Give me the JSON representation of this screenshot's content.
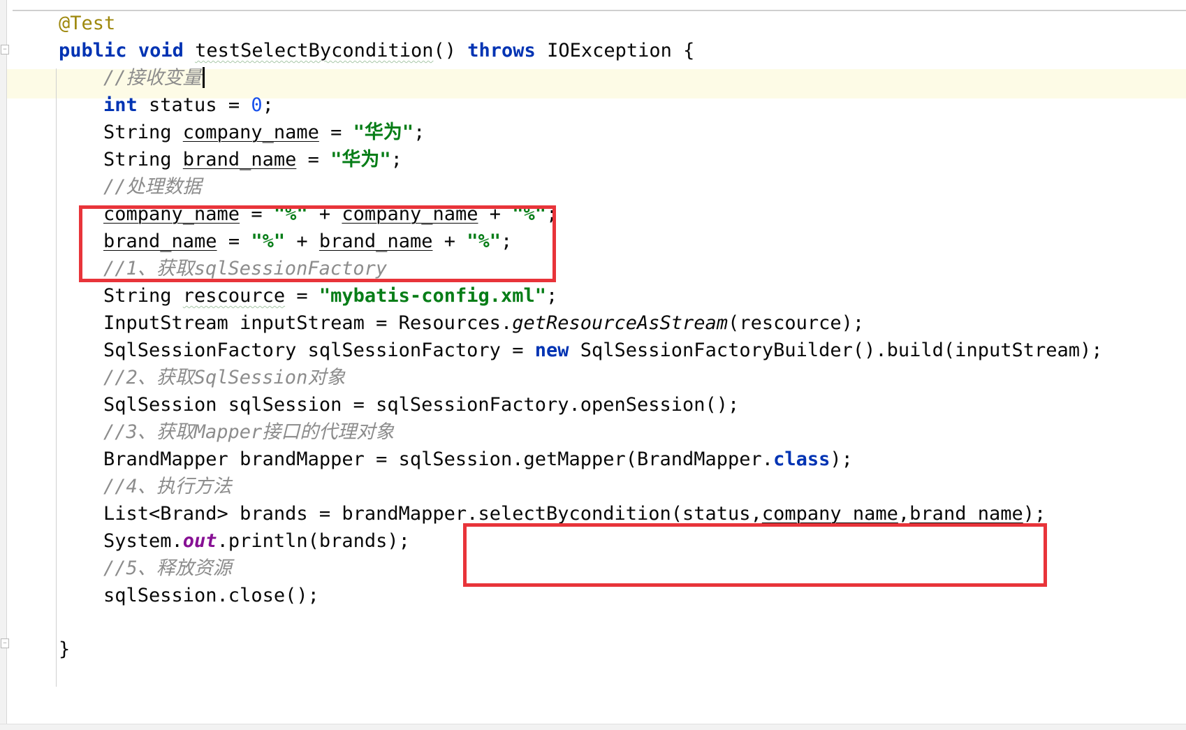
{
  "editor": {
    "annotation": "@Test",
    "method_signature": {
      "kw_public": "public",
      "kw_void": "void",
      "method_name": "testSelectBycondition",
      "parens": "() ",
      "kw_throws": "throws",
      "exception": " IOException {"
    },
    "comment_receive": "//接收变量",
    "line_status": {
      "kw_int": "int",
      "rest": " status = ",
      "value": "0",
      "end": ";"
    },
    "line_company": {
      "type": "String ",
      "var": "company_name",
      "eq": " = ",
      "value": "\"华为\"",
      "end": ";"
    },
    "line_brand": {
      "type": "String ",
      "var": "brand_name",
      "eq": " = ",
      "value": "\"华为\"",
      "end": ";"
    },
    "comment_process": "//处理数据",
    "line_company_wrap": {
      "var": "company_name",
      "eq": " = ",
      "pct1": "\"%\"",
      "plus1": " + ",
      "var2": "company_name",
      "plus2": " + ",
      "pct2": "\"%\"",
      "end": ";"
    },
    "line_brand_wrap": {
      "var": "brand_name",
      "eq": " = ",
      "pct1": "\"%\"",
      "plus1": " + ",
      "var2": "brand_name",
      "plus2": " + ",
      "pct2": "\"%\"",
      "end": ";"
    },
    "comment_step1": "//1、获取sqlSessionFactory",
    "line_resource": {
      "type": "String ",
      "var": "rescource",
      "eq": " = ",
      "value": "\"mybatis-config.xml\"",
      "end": ";"
    },
    "line_inputstream": {
      "pre": "InputStream inputStream = Resources.",
      "call": "getResourceAsStream",
      "post": "(rescource);"
    },
    "line_factory": {
      "pre": "SqlSessionFactory sqlSessionFactory = ",
      "kw_new": "new",
      "post": " SqlSessionFactoryBuilder().build(inputStream);"
    },
    "comment_step2": "//2、获取SqlSession对象",
    "line_session": "SqlSession sqlSession = sqlSessionFactory.openSession();",
    "comment_step3": "//3、获取Mapper接口的代理对象",
    "line_mapper": {
      "pre": "BrandMapper brandMapper = sqlSession.getMapper(BrandMapper.",
      "kw_class": "class",
      "post": ");"
    },
    "comment_step4": "//4、执行方法",
    "line_select": {
      "pre": "List<Brand> brands = brandMapper.",
      "call": "selectBycondition(status,",
      "arg2": "company_name",
      "comma": ",",
      "arg3": "brand_name",
      "end": ");"
    },
    "line_print": {
      "pre": "System.",
      "field": "out",
      "post": ".println(brands);"
    },
    "comment_step5": "//5、释放资源",
    "line_close": "sqlSession.close();",
    "closing_brace": "}"
  },
  "colors": {
    "keyword": "#0033b3",
    "string": "#067d17",
    "number": "#1750eb",
    "comment": "#8c8c8c",
    "annotation": "#9e880d",
    "static_field": "#871094",
    "highlight_box": "#e8343a",
    "current_line": "#fdfbe6"
  }
}
